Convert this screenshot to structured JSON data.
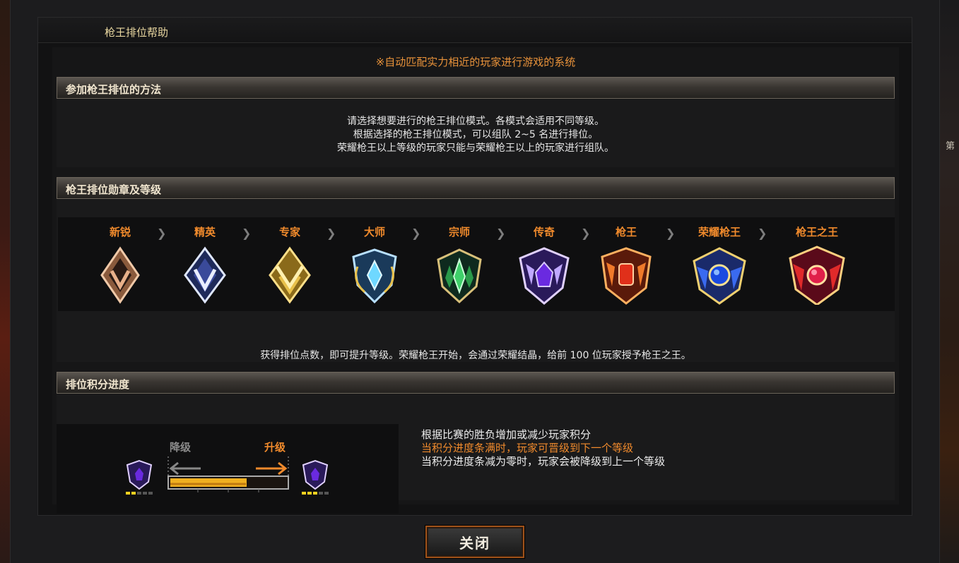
{
  "dialog": {
    "title": "枪王排位帮助",
    "subtitle": "※自动匹配实力相近的玩家进行游戏的系统"
  },
  "section_join": {
    "header": "参加枪王排位的方法",
    "lines": [
      "请选择想要进行的枪王排位模式。各模式会适用不同等级。",
      "根据选择的枪王排位模式，可以组队 2~5 名进行排位。",
      "荣耀枪王以上等级的玩家只能与荣耀枪王以上的玩家进行组队。"
    ]
  },
  "section_ranks": {
    "header": "枪王排位勋章及等级",
    "ranks": [
      {
        "label": "新锐",
        "icon": "bronze-rank-badge-icon",
        "color": "#d9a27a"
      },
      {
        "label": "精英",
        "icon": "silver-rank-badge-icon",
        "color": "#c9d6f2"
      },
      {
        "label": "专家",
        "icon": "gold-rank-badge-icon",
        "color": "#e8c04a"
      },
      {
        "label": "大师",
        "icon": "platinum-rank-badge-icon",
        "color": "#4fb8f0"
      },
      {
        "label": "宗师",
        "icon": "emerald-rank-badge-icon",
        "color": "#3fcf6a"
      },
      {
        "label": "传奇",
        "icon": "amethyst-rank-badge-icon",
        "color": "#8a4cf0"
      },
      {
        "label": "枪王",
        "icon": "ruby-rank-badge-icon",
        "color": "#f0582a"
      },
      {
        "label": "荣耀枪王",
        "icon": "sapphire-rank-badge-icon",
        "color": "#2a6cf0"
      },
      {
        "label": "枪王之王",
        "icon": "crimson-crown-rank-badge-icon",
        "color": "#e02a4a"
      }
    ],
    "note": "获得排位点数，即可提升等级。荣耀枪王开始，会通过荣耀结晶，给前 100 位玩家授予枪王之王。"
  },
  "section_progress": {
    "header": "排位积分进度",
    "demote_label": "降级",
    "promote_label": "升级",
    "progress_fill": 0.66,
    "lines": [
      "根据比赛的胜负增加或减少玩家积分",
      "当积分进度条满时，玩家可晋级到下一个等级",
      "当积分进度条减为零时，玩家会被降级到上一个等级"
    ]
  },
  "footer": {
    "close_label": "关闭"
  },
  "background": {
    "right_edge_text": "第"
  }
}
